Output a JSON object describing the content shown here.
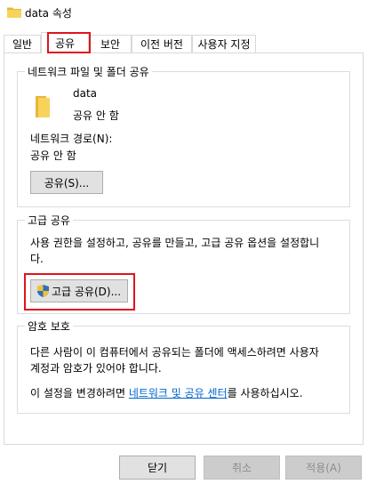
{
  "window": {
    "title": "data 속성"
  },
  "tabs": [
    {
      "label": "일반"
    },
    {
      "label": "공유"
    },
    {
      "label": "보안"
    },
    {
      "label": "이전 버전"
    },
    {
      "label": "사용자 지정"
    }
  ],
  "network_share": {
    "group_title": "네트워크 파일 및 폴더 공유",
    "folder_name": "data",
    "share_status": "공유 안 함",
    "path_label": "네트워크 경로(N):",
    "path_value": "공유 안 함",
    "share_button": "공유(S)..."
  },
  "advanced_share": {
    "group_title": "고급 공유",
    "description_line1": "사용 권한을 설정하고, 공유를 만들고, 고급 공유 옵션을 설정합니",
    "description_line2": "다.",
    "button": "고급 공유(D)..."
  },
  "password": {
    "group_title": "암호 보호",
    "line1": "다른 사람이 이 컴퓨터에서 공유되는 폴더에 액세스하려면 사용자",
    "line2": "계정과 암호가 있어야 합니다.",
    "line3_prefix": "이 설정을 변경하려면 ",
    "link": "네트워크 및 공유 센터",
    "line3_suffix": "를 사용하십시오."
  },
  "footer": {
    "close": "닫기",
    "cancel": "취소",
    "apply": "적용(A)"
  },
  "colors": {
    "highlight": "#e0141e",
    "link": "#0066cc",
    "folder": "#f5c542"
  }
}
